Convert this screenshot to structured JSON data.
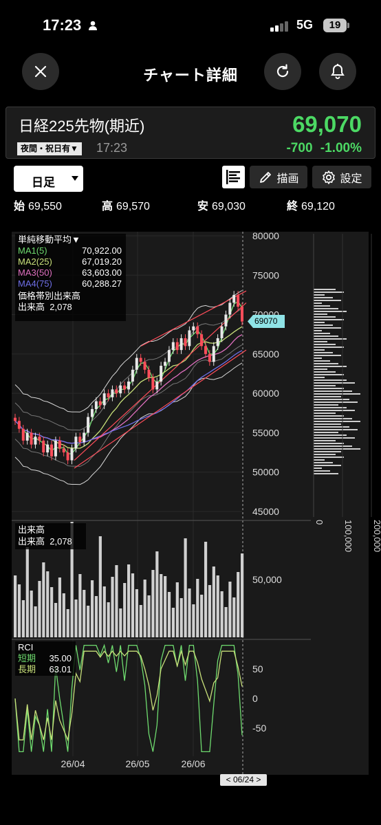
{
  "status": {
    "time": "17:23",
    "network": "5G",
    "battery": "19"
  },
  "header": {
    "title": "チャート詳細"
  },
  "quote": {
    "name": "日経225先物(期近)",
    "price": "69,070",
    "session": "夜間・祝日有▼",
    "time": "17:23",
    "change": "-700",
    "change_pct": "-1.00%"
  },
  "toolbar": {
    "period": "日足",
    "draw_label": "描画",
    "settings_label": "設定"
  },
  "ohlc": {
    "open_label": "始",
    "open": "69,550",
    "high_label": "高",
    "high": "69,570",
    "low_label": "安",
    "low": "69,030",
    "close_label": "終",
    "close": "69,120"
  },
  "legend": {
    "sma_title": "単純移動平均▼",
    "ma": [
      {
        "label": "MA1(5)",
        "value": "70,922.00",
        "color": "#6fdc6f"
      },
      {
        "label": "MA2(25)",
        "value": "67,019.20",
        "color": "#c8e07a"
      },
      {
        "label": "MA3(50)",
        "value": "63,603.00",
        "color": "#e070c0"
      },
      {
        "label": "MA4(75)",
        "value": "60,288.27",
        "color": "#6f6fe8"
      }
    ],
    "vp_title": "価格帯別出来高",
    "vp_label": "出来高",
    "vp_value": "2,078"
  },
  "volume_legend": {
    "title": "出来高",
    "label": "出来高",
    "value": "2,078"
  },
  "rci_legend": {
    "title": "RCI",
    "short_label": "短期",
    "short_value": "35.00",
    "long_label": "長期",
    "long_value": "63.01"
  },
  "chart_data": {
    "type": "candlestick",
    "price_axis": {
      "ticks": [
        "80000",
        "75000",
        "70000",
        "65000",
        "60000",
        "55000",
        "50000",
        "45000"
      ],
      "range": [
        45000,
        80000
      ]
    },
    "last_price_flag": "69070",
    "volume_axis": {
      "ticks": [
        "50,000"
      ]
    },
    "rci_axis": {
      "ticks": [
        "50",
        "0",
        "-50"
      ],
      "range": [
        -100,
        100
      ]
    },
    "volume_profile_axis": {
      "ticks": [
        "0",
        "100,000",
        "200,000"
      ]
    },
    "x_ticks": [
      "26/04",
      "26/05",
      "26/06"
    ],
    "crosshair_date": "< 06/24 >",
    "close_path": [
      56500,
      55500,
      54000,
      55000,
      53500,
      54500,
      54000,
      52500,
      53500,
      52000,
      54000,
      53000,
      52500,
      51500,
      53000,
      54500,
      53800,
      55000,
      57000,
      58000,
      59000,
      58500,
      60000,
      59500,
      60500,
      60000,
      61000,
      60500,
      61500,
      63000,
      64500,
      64000,
      63000,
      62000,
      60500,
      61500,
      63500,
      64000,
      65500,
      66500,
      65500,
      67000,
      66000,
      68000,
      68500,
      67500,
      66000,
      65000,
      64000,
      66000,
      67000,
      68500,
      70000,
      71500,
      72500,
      71000,
      69120
    ],
    "colors": {
      "up": "#e8e8e8",
      "down": "#ff4d5a",
      "bb": "#d8d8d8",
      "trend": "#ff4d5a"
    }
  }
}
